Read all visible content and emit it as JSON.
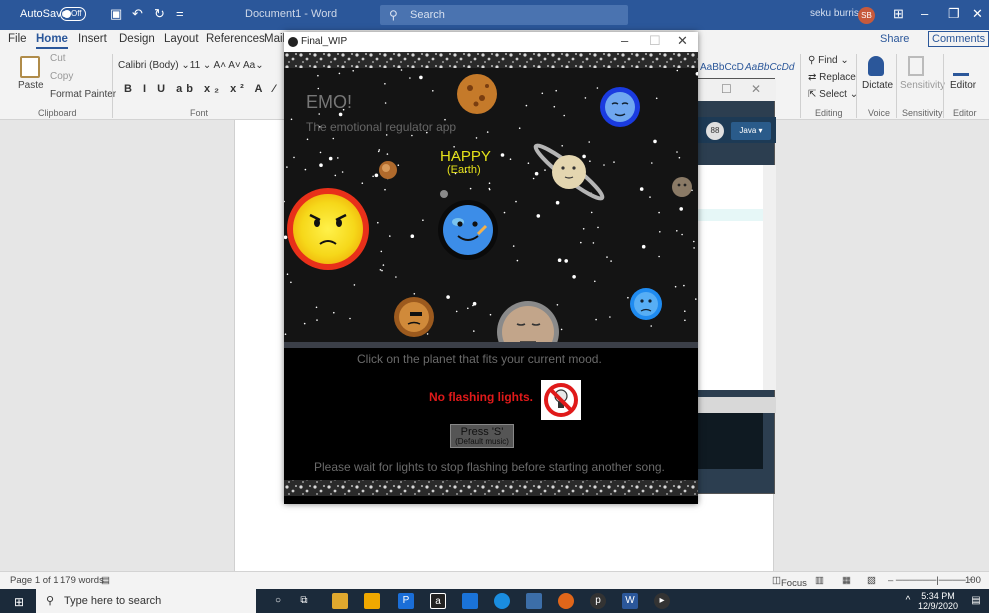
{
  "word": {
    "autosave_label": "AutoSave",
    "autosave_state": "Off",
    "doc_title": "Document1  -  Word",
    "search_placeholder": "Search",
    "user_name": "seku burris",
    "user_initials": "SB",
    "tabs": [
      "File",
      "Home",
      "Insert",
      "Design",
      "Layout",
      "References",
      "Maili"
    ],
    "share": "Share",
    "comments": "Comments",
    "clipboard": {
      "cut": "Cut",
      "copy": "Copy",
      "paste": "Paste",
      "format_painter": "Format Painter",
      "group": "Clipboard"
    },
    "font": {
      "name": "Calibri (Body)",
      "size": "11",
      "group": "Font"
    },
    "styles": [
      "AaBbCcD",
      "AaBbCcDd"
    ],
    "editing": {
      "find": "Find",
      "replace": "Replace",
      "select": "Select",
      "group": "Editing"
    },
    "voice": {
      "dictate": "Dictate",
      "group": "Voice"
    },
    "sensitivity": {
      "label": "Sensitivity",
      "group": "Sensitivity"
    },
    "editor": {
      "label": "Editor",
      "group": "Editor"
    },
    "status": {
      "page": "Page 1 of 1",
      "words": "179 words",
      "focus": "Focus",
      "zoom": "100"
    }
  },
  "ide": {
    "language": "Java"
  },
  "sketch": {
    "window_title": "Final_WIP",
    "app_title": "EMO!",
    "app_subtitle": "The emotional regulator app",
    "mood_label": "HAPPY",
    "mood_planet": "(Earth)",
    "instruction": "Click on the planet that fits your current mood.",
    "warning": "No flashing lights.",
    "button_label": "Press 'S'",
    "button_sublabel": "(Default music)",
    "footer_note": "Please wait for lights to stop flashing before starting another song.",
    "colors": {
      "warning": "#e01a1a",
      "mood": "#e6e21a",
      "sun": "#f4e21a",
      "sun_ring": "#e8301a",
      "earth": "#3c8de8"
    }
  },
  "taskbar": {
    "search_placeholder": "Type here to search",
    "time": "5:34 PM",
    "date": "12/9/2020"
  }
}
